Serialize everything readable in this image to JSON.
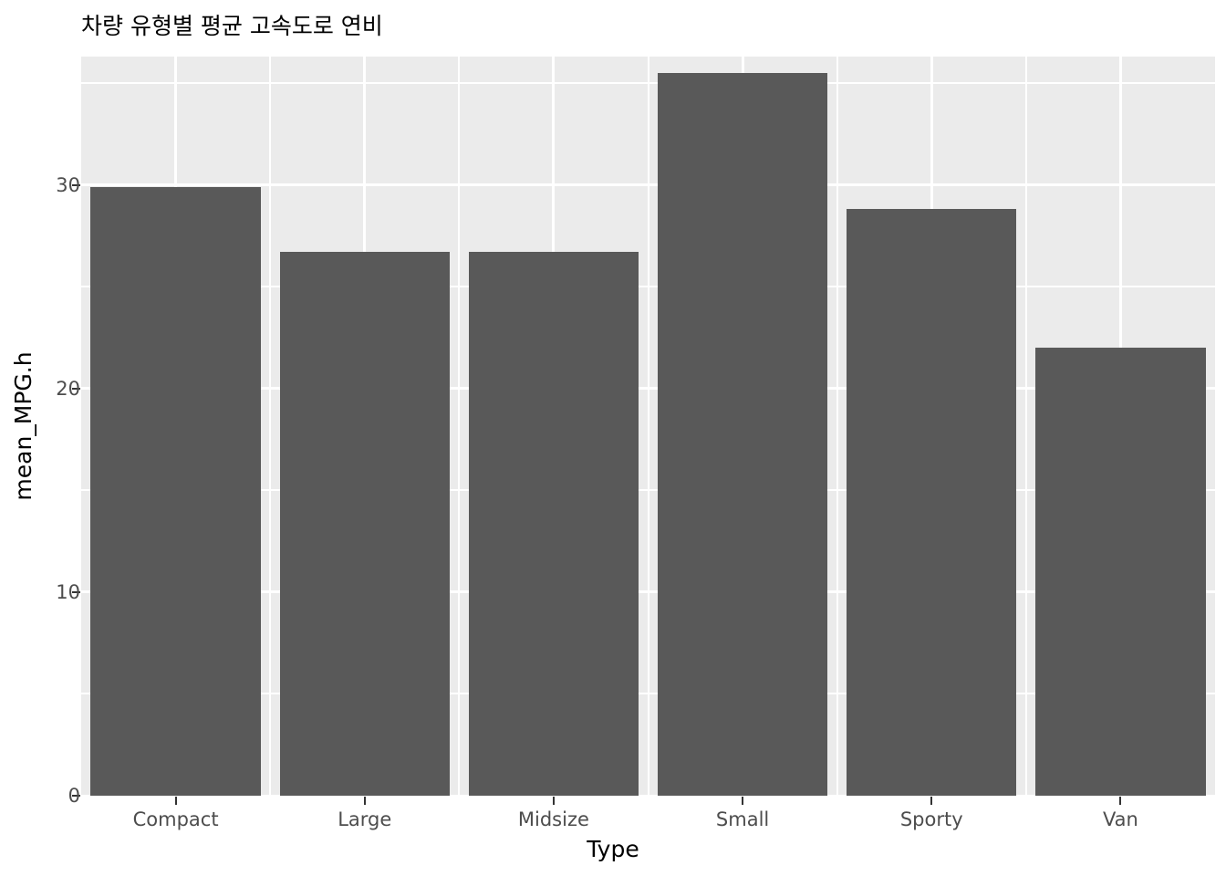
{
  "chart_data": {
    "type": "bar",
    "title": "차량 유형별 평균 고속도로 연비",
    "xlabel": "Type",
    "ylabel": "mean_MPG.h",
    "categories": [
      "Compact",
      "Large",
      "Midsize",
      "Small",
      "Sporty",
      "Van"
    ],
    "values": [
      29.9,
      26.7,
      26.7,
      35.5,
      28.8,
      22.0
    ],
    "ylim": [
      0,
      36.3
    ],
    "xlim_categories": 6,
    "y_ticks": [
      0,
      10,
      20,
      30
    ],
    "y_tick_labels": [
      "0",
      "10",
      "20",
      "30"
    ],
    "y_minor_ticks": [
      5,
      15,
      25,
      35
    ],
    "grid": true,
    "legend": "none",
    "theme": "ggplot2-grey",
    "colors": {
      "bar_fill": "#595959",
      "panel_background": "#EBEBEB",
      "grid_line": "#FFFFFF",
      "plot_background": "#FFFFFF",
      "axis_text": "#4D4D4D",
      "axis_title": "#000000",
      "title_text": "#000000"
    }
  },
  "axes": {
    "y_title": "mean_MPG.h",
    "x_title": "Type"
  }
}
